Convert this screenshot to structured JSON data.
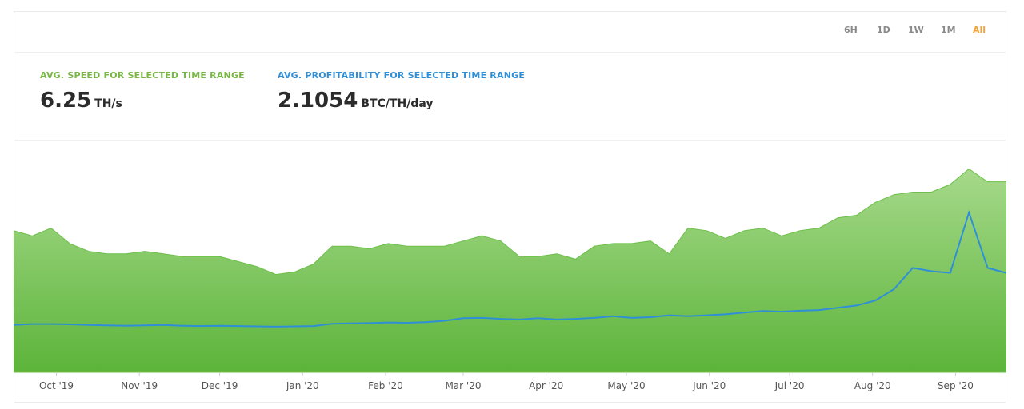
{
  "range_buttons": [
    {
      "label": "6H",
      "active": false
    },
    {
      "label": "1D",
      "active": false
    },
    {
      "label": "1W",
      "active": false
    },
    {
      "label": "1M",
      "active": false
    },
    {
      "label": "All",
      "active": true
    }
  ],
  "stats": {
    "speed": {
      "label": "AVG. SPEED FOR SELECTED TIME RANGE",
      "value": "6.25",
      "unit": "TH/s"
    },
    "profitability": {
      "label": "AVG. PROFITABILITY FOR SELECTED TIME RANGE",
      "value": "2.1054",
      "unit": "BTC/TH/day"
    }
  },
  "colors": {
    "speed_fill": "#6cbf4a",
    "speed_line": "#6cbf4a",
    "profitability_line": "#2f8fd6",
    "active_range": "#f3a33b"
  },
  "chart_data": {
    "type": "area",
    "x_tick_labels": [
      "Oct '19",
      "Nov '19",
      "Dec '19",
      "Jan '20",
      "Feb '20",
      "Mar '20",
      "Apr '20",
      "May '20",
      "Jun '20",
      "Jul '20",
      "Aug '20",
      "Sep '20"
    ],
    "x": [
      "2019-09-15",
      "2019-09-22",
      "2019-09-29",
      "2019-10-06",
      "2019-10-13",
      "2019-10-20",
      "2019-10-27",
      "2019-11-03",
      "2019-11-10",
      "2019-11-17",
      "2019-11-24",
      "2019-12-01",
      "2019-12-08",
      "2019-12-15",
      "2019-12-22",
      "2019-12-29",
      "2020-01-05",
      "2020-01-12",
      "2020-01-19",
      "2020-01-26",
      "2020-02-02",
      "2020-02-09",
      "2020-02-16",
      "2020-02-23",
      "2020-03-01",
      "2020-03-08",
      "2020-03-15",
      "2020-03-22",
      "2020-03-29",
      "2020-04-05",
      "2020-04-12",
      "2020-04-19",
      "2020-04-26",
      "2020-05-03",
      "2020-05-10",
      "2020-05-17",
      "2020-05-24",
      "2020-05-31",
      "2020-06-07",
      "2020-06-14",
      "2020-06-21",
      "2020-06-28",
      "2020-07-05",
      "2020-07-12",
      "2020-07-19",
      "2020-07-26",
      "2020-08-02",
      "2020-08-09",
      "2020-08-16",
      "2020-08-23",
      "2020-08-30",
      "2020-09-06",
      "2020-09-13",
      "2020-09-20"
    ],
    "series": [
      {
        "values": [
          5.5,
          5.3,
          5.6,
          5.0,
          4.7,
          4.6,
          4.6,
          4.7,
          4.6,
          4.5,
          4.5,
          4.5,
          4.3,
          4.1,
          3.8,
          3.9,
          4.2,
          4.9,
          4.9,
          4.8,
          5.0,
          4.9,
          4.9,
          4.9,
          5.1,
          5.3,
          5.1,
          4.5,
          4.5,
          4.6,
          4.4,
          4.9,
          5.0,
          5.0,
          5.1,
          4.6,
          5.6,
          5.5,
          5.2,
          5.5,
          5.6,
          5.3,
          5.5,
          5.6,
          6.0,
          6.1,
          6.6,
          6.9,
          7.0,
          7.0,
          7.3,
          7.9,
          7.4,
          7.4
        ]
      },
      {
        "values": [
          1.45,
          1.48,
          1.48,
          1.47,
          1.45,
          1.44,
          1.43,
          1.44,
          1.45,
          1.43,
          1.42,
          1.43,
          1.42,
          1.41,
          1.4,
          1.41,
          1.42,
          1.49,
          1.5,
          1.51,
          1.53,
          1.52,
          1.54,
          1.58,
          1.66,
          1.67,
          1.64,
          1.62,
          1.66,
          1.62,
          1.64,
          1.67,
          1.72,
          1.67,
          1.69,
          1.75,
          1.72,
          1.75,
          1.78,
          1.83,
          1.88,
          1.86,
          1.89,
          1.91,
          1.98,
          2.05,
          2.2,
          2.55,
          3.2,
          3.1,
          3.05,
          4.9,
          3.2,
          3.05
        ]
      }
    ]
  }
}
